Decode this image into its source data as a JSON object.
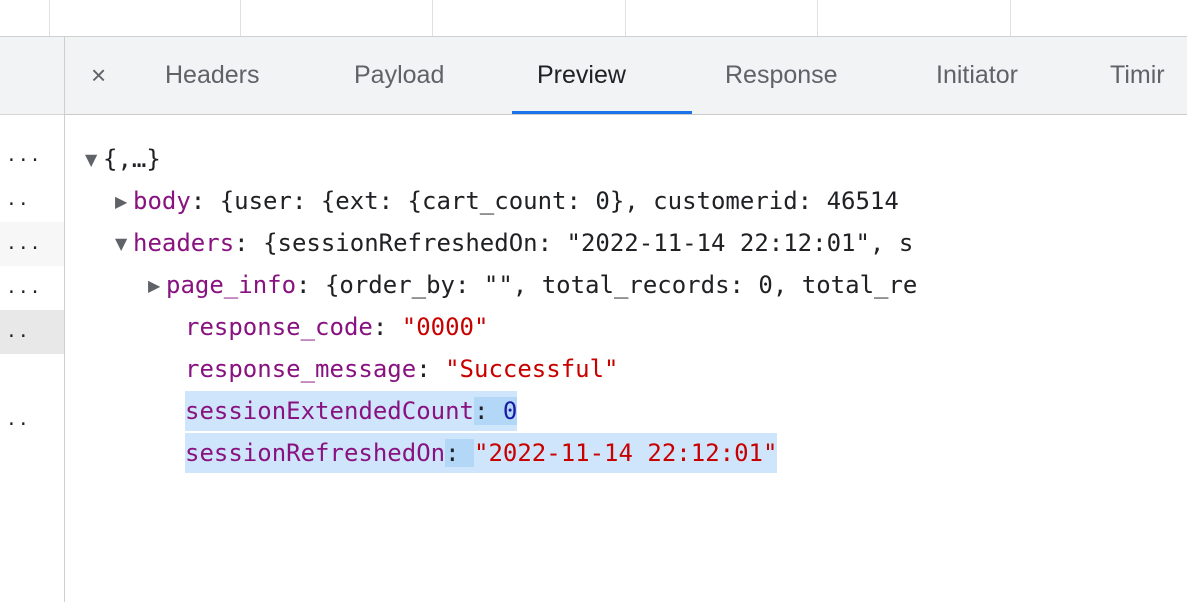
{
  "tabs": [
    {
      "label": "Headers"
    },
    {
      "label": "Payload"
    },
    {
      "label": "Preview"
    },
    {
      "label": "Response"
    },
    {
      "label": "Initiator"
    },
    {
      "label": "Timir"
    }
  ],
  "close_glyph": "×",
  "left_rows": [
    "...",
    "..",
    "...",
    "...",
    "..",
    "",
    ".."
  ],
  "preview": {
    "root": "{,…}",
    "body_key": "body",
    "body_val": "{user: {ext: {cart_count: 0}, customerid: 46514",
    "headers_key": "headers",
    "headers_val": "{sessionRefreshedOn: \"2022-11-14 22:12:01\", s",
    "page_info_key": "page_info",
    "page_info_val": "{order_by: \"\", total_records: 0, total_re",
    "response_code_key": "response_code",
    "response_code_val": "\"0000\"",
    "response_message_key": "response_message",
    "response_message_val": "\"Successful\"",
    "session_ext_key": "sessionExtendedCount",
    "session_ext_val": "0",
    "session_ref_key": "sessionRefreshedOn",
    "session_ref_val": "\"2022-11-14 22:12:01\""
  }
}
